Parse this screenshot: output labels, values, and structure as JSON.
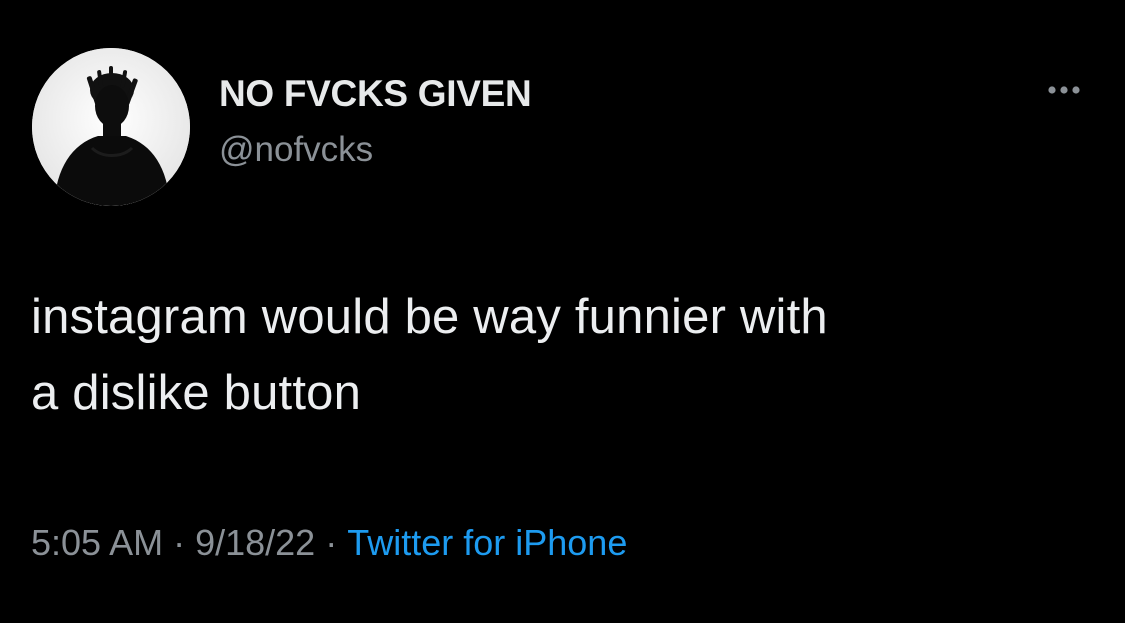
{
  "user": {
    "display_name": "NO FVCKS GIVEN",
    "handle": "@nofvcks"
  },
  "tweet": {
    "text_line_1": "instagram would be way funnier with",
    "text_line_2": "a dislike button"
  },
  "meta": {
    "time": "5:05 AM",
    "separator": "·",
    "date": "9/18/22",
    "source": "Twitter for iPhone"
  },
  "icons": {
    "more": "more-horizontal-icon",
    "avatar": "profile-avatar"
  },
  "colors": {
    "background": "#000000",
    "primary_text": "#e7e9ea",
    "secondary_text": "#8b9197",
    "link": "#1d9bf0"
  }
}
